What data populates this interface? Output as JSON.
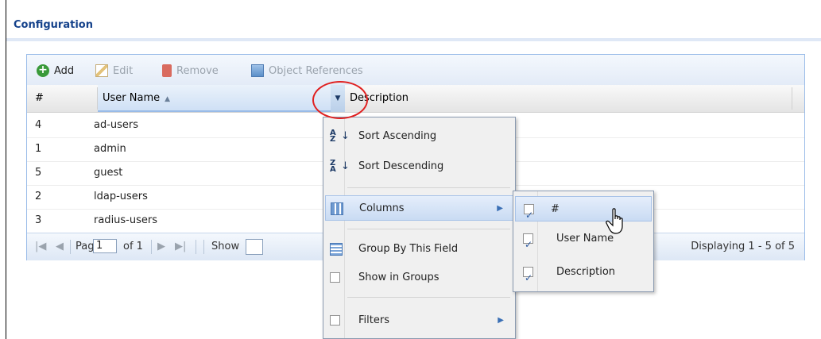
{
  "section": {
    "title": "Configuration"
  },
  "toolbar": {
    "add": "Add",
    "edit": "Edit",
    "remove": "Remove",
    "object_references": "Object References"
  },
  "grid": {
    "columns": {
      "num": "#",
      "user_name": "User Name",
      "description": "Description"
    },
    "rows": [
      {
        "num": "4",
        "user_name": "ad-users"
      },
      {
        "num": "1",
        "user_name": "admin"
      },
      {
        "num": "5",
        "user_name": "guest"
      },
      {
        "num": "2",
        "user_name": "ldap-users"
      },
      {
        "num": "3",
        "user_name": "radius-users"
      }
    ]
  },
  "pager": {
    "page_label": "Page",
    "page_value": "1",
    "of_label": "of 1",
    "show_label": "Show",
    "display_info": "Displaying 1 - 5 of 5"
  },
  "column_menu": {
    "sort_asc": "Sort Ascending",
    "sort_desc": "Sort Descending",
    "columns": "Columns",
    "group_by": "Group By This Field",
    "show_in_groups": "Show in Groups",
    "filters": "Filters"
  },
  "columns_submenu": [
    {
      "label": "#",
      "checked": true
    },
    {
      "label": "User Name",
      "checked": true
    },
    {
      "label": "Description",
      "checked": true
    }
  ],
  "colors": {
    "accent": "#15428b",
    "highlight_circle": "#e02020"
  }
}
